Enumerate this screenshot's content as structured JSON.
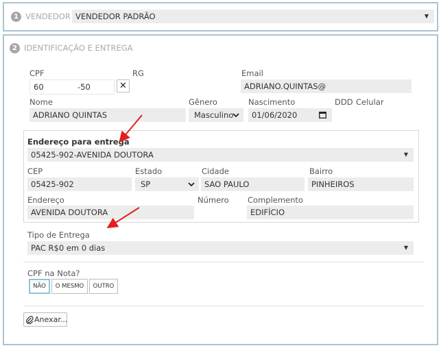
{
  "section1": {
    "step": "1",
    "label": "VENDEDOR",
    "select_value": "VENDEDOR PADRÃO"
  },
  "section2": {
    "step": "2",
    "label": "IDENTIFICAÇÃO E ENTREGA"
  },
  "cpf": {
    "label": "CPF",
    "value_start": "60",
    "value_end": "-50"
  },
  "clear_icon": "close-icon",
  "rg": {
    "label": "RG",
    "value": ""
  },
  "email": {
    "label": "Email",
    "value": "ADRIANO.QUINTAS@"
  },
  "nome": {
    "label": "Nome",
    "value": "ADRIANO QUINTAS"
  },
  "genero": {
    "label": "Gênero",
    "value": "Masculino"
  },
  "nascimento": {
    "label": "Nascimento",
    "value": "01/06/2020"
  },
  "ddd": {
    "label": "DDD",
    "value": ""
  },
  "celular": {
    "label": "Celular",
    "value": ""
  },
  "endereco_entrega": {
    "label": "Endereço para entrega",
    "value": "05425-902-AVENIDA DOUTORA"
  },
  "cep": {
    "label": "CEP",
    "value": "05425-902"
  },
  "estado": {
    "label": "Estado",
    "value": "SP"
  },
  "cidade": {
    "label": "Cidade",
    "value": "SAO PAULO"
  },
  "bairro": {
    "label": "Bairro",
    "value": "PINHEIROS"
  },
  "endereco": {
    "label": "Endereço",
    "value": "AVENIDA DOUTORA"
  },
  "numero": {
    "label": "Número",
    "value": ""
  },
  "complemento": {
    "label": "Complemento",
    "value": "EDIFÍCIO"
  },
  "tipo_entrega": {
    "label": "Tipo de Entrega",
    "value": "PAC R$0 em 0 dias"
  },
  "cpf_nota": {
    "label": "CPF na Nota?",
    "options": [
      "NÃO",
      "O MESMO",
      "OUTRO"
    ],
    "selected": "NÃO"
  },
  "attach_button": {
    "label": "Anexar...",
    "icon": "paperclip-icon"
  },
  "colors": {
    "panel_border": "#aac3d0",
    "field_bg": "#ececec",
    "arrow": "#e02020",
    "selected_border": "#8dc4d6"
  }
}
